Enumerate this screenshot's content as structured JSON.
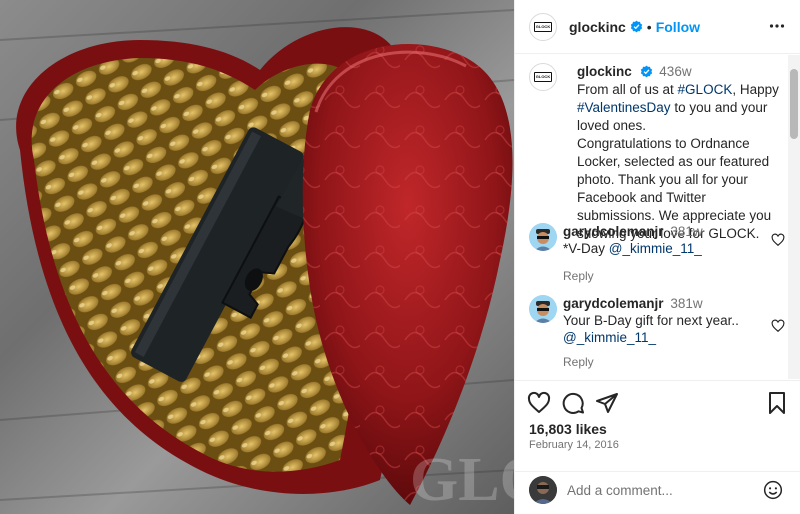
{
  "post": {
    "author": "glockinc",
    "follow_label": "Follow",
    "separator": "•",
    "caption": {
      "author": "glockinc",
      "time": "436w",
      "pre": "From all of us at ",
      "tag1": "#GLOCK",
      "mid": ", Happy ",
      "tag2": "#ValentinesDay",
      "post": " to you and your loved ones.",
      "para2": "Congratulations to Ordnance Locker, selected as our featured photo. Thank you all for your Facebook and Twitter submissions. We appreciate you showing your love for GLOCK."
    },
    "comments": [
      {
        "user": "garydcolemanjr",
        "time": "381w",
        "text": "*V-Day ",
        "mention": "@_kimmie_11_",
        "reply": "Reply"
      },
      {
        "user": "garydcolemanjr",
        "time": "381w",
        "text": "Your B-Day gift for next year.. ",
        "mention": "@_kimmie_11_",
        "reply": "Reply"
      }
    ],
    "likes": "16,803 likes",
    "date": "February 14, 2016",
    "add_comment_placeholder": "Add a comment...",
    "logo_text": "GLOCK",
    "watermark": "GLO"
  },
  "colors": {
    "accent": "#0095f6",
    "verified": "#0095f6",
    "hashtag": "#00376b"
  }
}
